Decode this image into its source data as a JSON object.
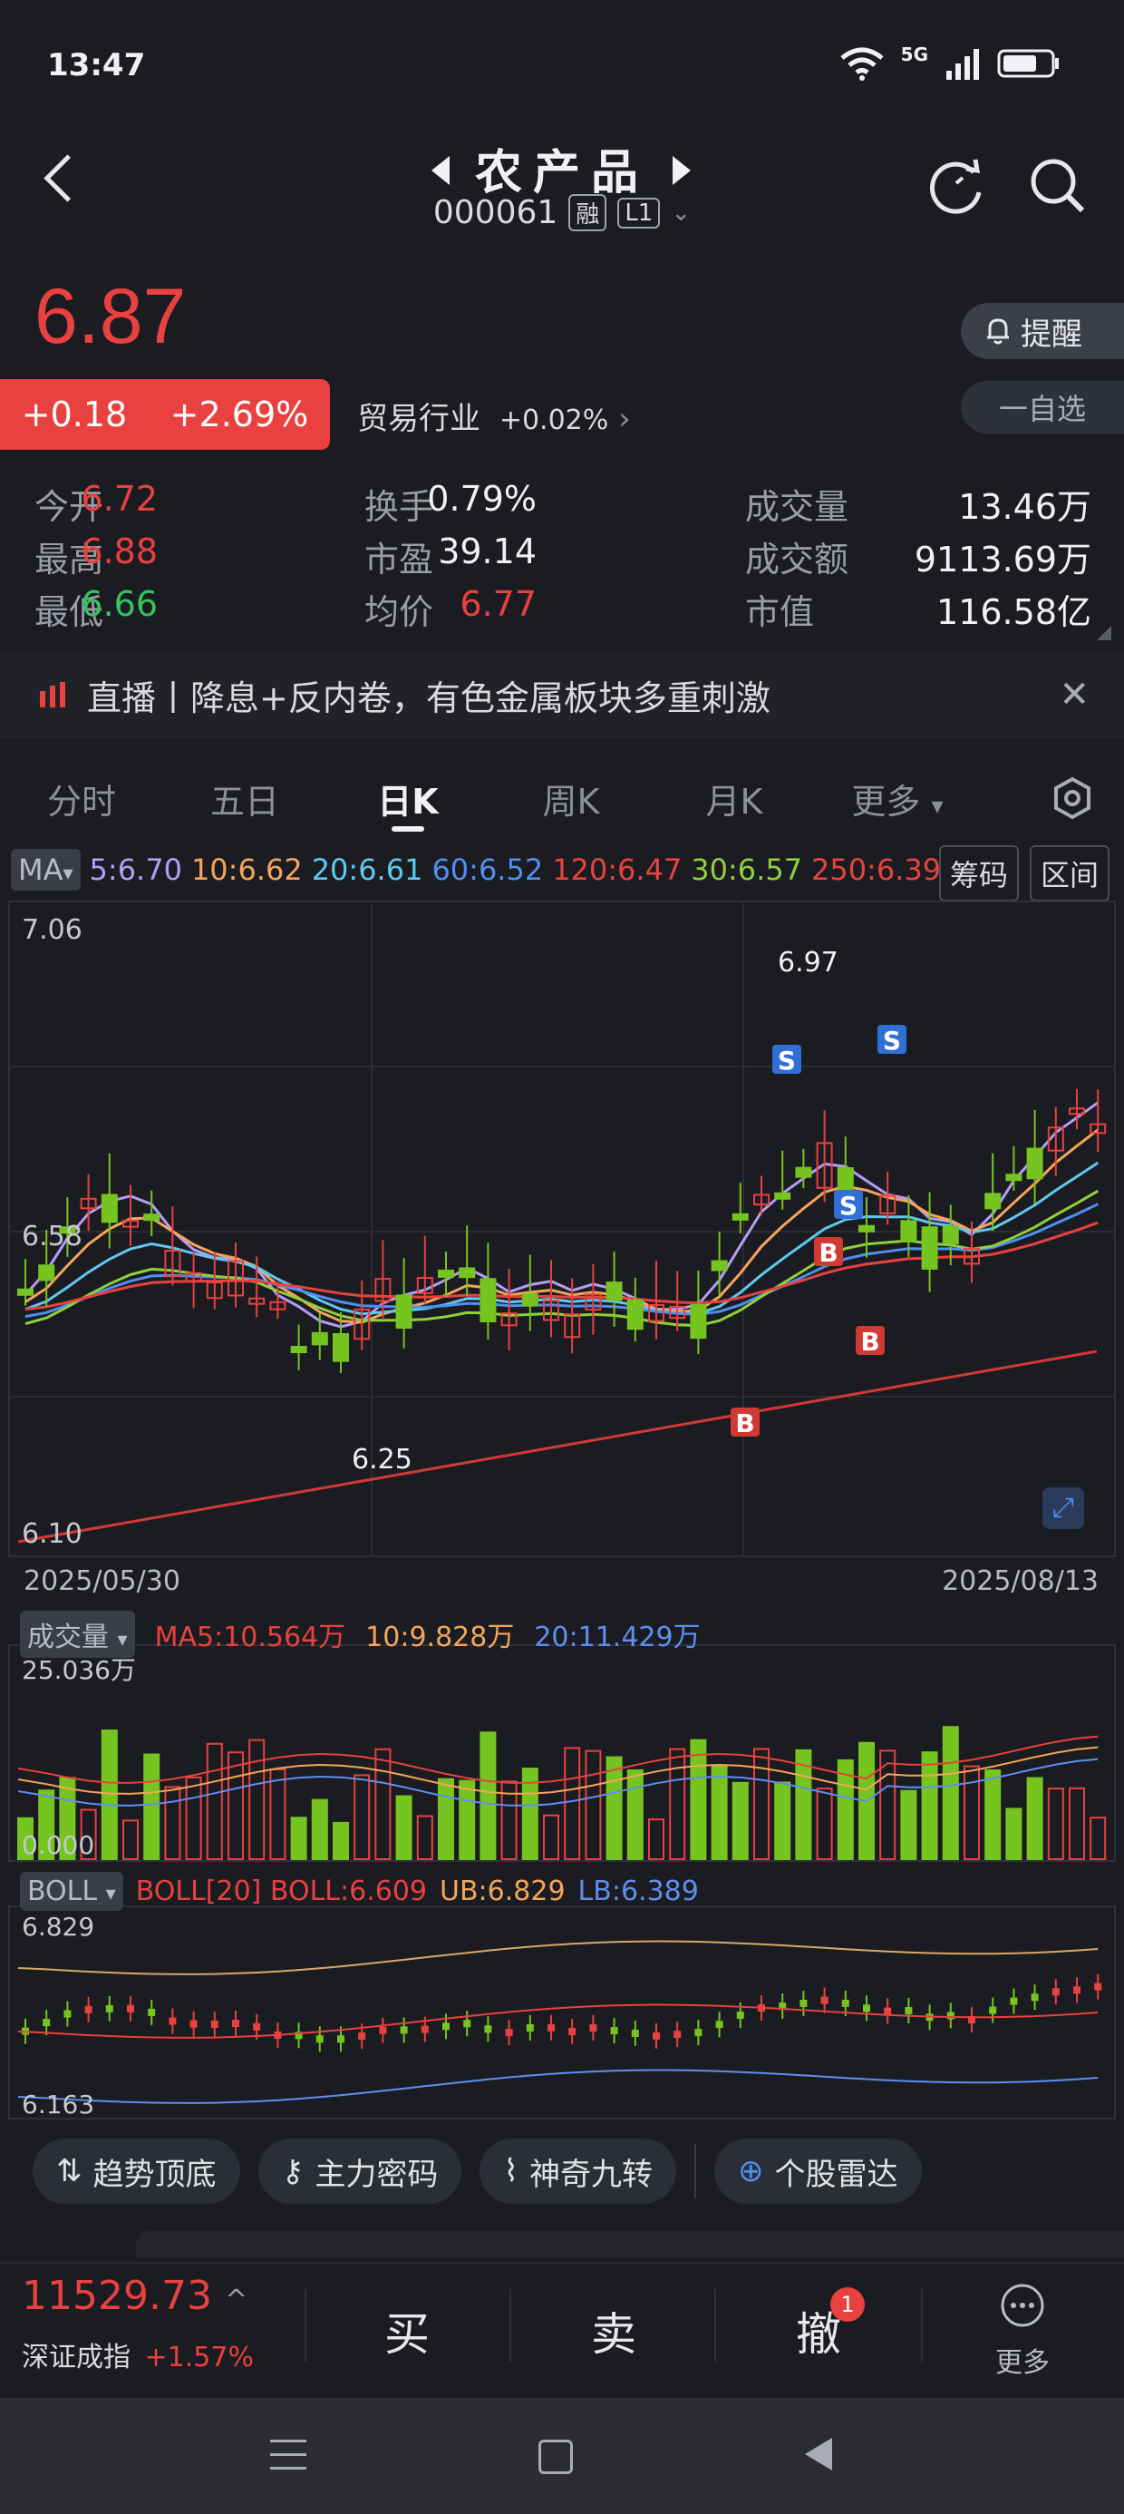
{
  "status_bar": {
    "time": "13:47",
    "network": "5G"
  },
  "header": {
    "title": "农产品",
    "code": "000061",
    "badge_margin": "融",
    "badge_level": "L1"
  },
  "quote": {
    "price": "6.87",
    "change": "+0.18",
    "change_pct": "+2.69%",
    "industry_label": "贸易行业",
    "industry_change": "+0.02%",
    "alert_label": "提醒",
    "watch_label": "一自选"
  },
  "stats": [
    {
      "label": "今开",
      "value": "6.72",
      "color": "red"
    },
    {
      "label": "换手",
      "value": "0.79%",
      "color": "white"
    },
    {
      "label": "成交量",
      "value": "13.46万",
      "color": "white"
    },
    {
      "label": "最高",
      "value": "6.88",
      "color": "red"
    },
    {
      "label": "市盈",
      "value": "39.14",
      "color": "white"
    },
    {
      "label": "成交额",
      "value": "9113.69万",
      "color": "white"
    },
    {
      "label": "最低",
      "value": "6.66",
      "color": "green"
    },
    {
      "label": "均价",
      "value": "6.77",
      "color": "red"
    },
    {
      "label": "市值",
      "value": "116.58亿",
      "color": "white"
    }
  ],
  "news": {
    "text": "直播丨降息+反内卷，有色金属板块多重刺激"
  },
  "tabs": [
    "分时",
    "五日",
    "日K",
    "周K",
    "月K",
    "更多"
  ],
  "ma": {
    "selector": "MA",
    "items": [
      {
        "label": "5:6.70",
        "color": "#b59cf5"
      },
      {
        "label": "10:6.62",
        "color": "#f5a55a"
      },
      {
        "label": "20:6.61",
        "color": "#5fc8f0"
      },
      {
        "label": "60:6.52",
        "color": "#4e8ff0"
      },
      {
        "label": "120:6.47",
        "color": "#e8413f"
      },
      {
        "label": "30:6.57",
        "color": "#8fd13a"
      },
      {
        "label": "250:6.39",
        "color": "#e8413f"
      }
    ],
    "btn_chips": "筹码",
    "btn_range": "区间"
  },
  "kline": {
    "y_top": "7.06",
    "y_mid": "6.58",
    "y_bottom": "6.10",
    "high_label": "6.97",
    "low_label": "6.25",
    "date_start": "2025/05/30",
    "date_end": "2025/08/13"
  },
  "volume": {
    "selector": "成交量",
    "max_label": "25.036万",
    "zero_label": "0.000",
    "ma5": "MA5:10.564万",
    "ma10": "10:9.828万",
    "ma20": "20:11.429万"
  },
  "boll": {
    "selector": "BOLL",
    "mid": "BOLL[20] BOLL:6.609",
    "ub": "UB:6.829",
    "lb": "LB:6.389",
    "top_label": "6.829",
    "bottom_label": "6.163"
  },
  "tools": [
    "趋势顶底",
    "主力密码",
    "神奇九转",
    "个股雷达"
  ],
  "bottom": {
    "index_value": "11529.73",
    "index_name": "深证成指",
    "index_change": "+1.57%",
    "buy": "买",
    "sell": "卖",
    "cancel": "撤",
    "cancel_badge": "1",
    "more": "更多"
  }
}
